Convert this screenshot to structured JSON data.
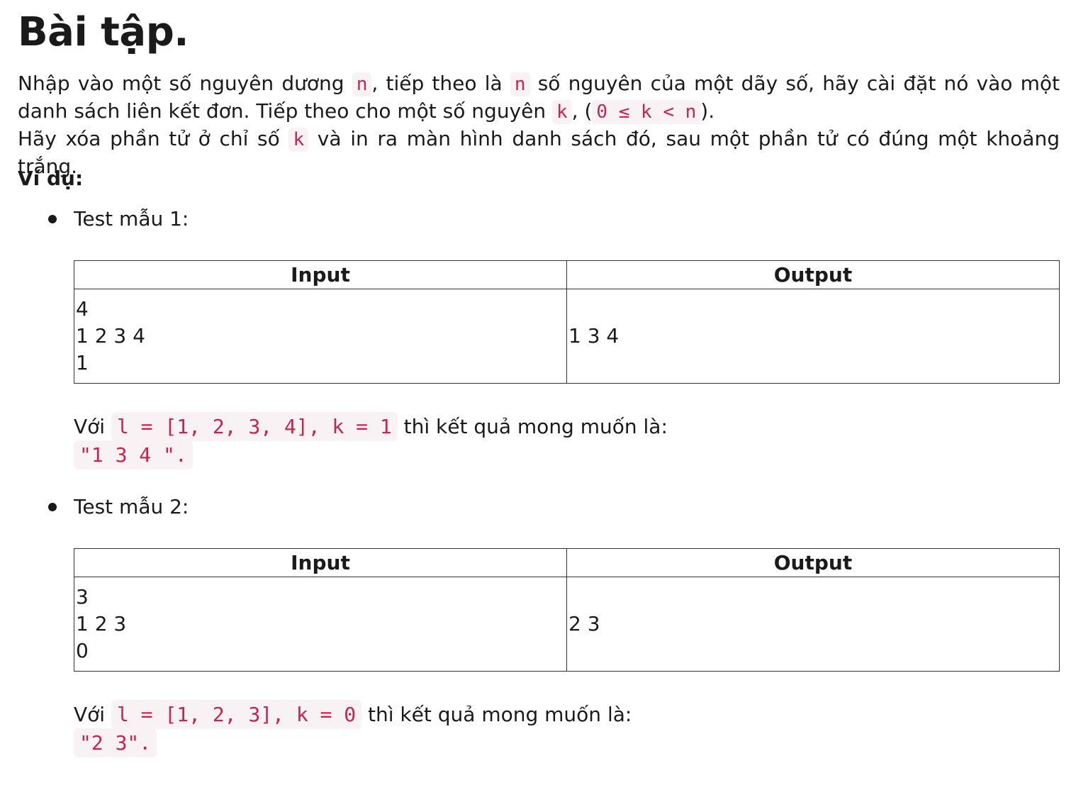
{
  "title": "Bài tập.",
  "description": {
    "line1_a": "Nhập vào một số nguyên dương ",
    "code_n": "n",
    "line1_b": ", tiếp theo là ",
    "line1_c": " số nguyên của một dãy số, hãy cài đặt nó vào một danh sách liên kết đơn. Tiếp theo cho một số nguyên ",
    "code_k": "k",
    "line2_a": ", (",
    "code_range": "0 ≤ k < n",
    "line2_b": ").",
    "line3_a": "Hãy xóa phần tử ở chỉ số ",
    "line3_b": " và in ra màn hình danh sách đó, sau một phần tử có đúng một khoảng trắng."
  },
  "example_label": "Ví dụ:",
  "tests": [
    {
      "label": "Test mẫu 1:",
      "input_header": "Input",
      "output_header": "Output",
      "input_lines": [
        "4",
        "1 2 3 4",
        "1"
      ],
      "output": "1 3 4",
      "note_prefix": "Với ",
      "note_code": "l = [1, 2, 3, 4], k = 1",
      "note_suffix": " thì kết quả mong muốn là:",
      "expected": "\"1 3 4 \"."
    },
    {
      "label": "Test mẫu 2:",
      "input_header": "Input",
      "output_header": "Output",
      "input_lines": [
        "3",
        "1 2 3",
        "0"
      ],
      "output": "2 3",
      "note_prefix": "Với ",
      "note_code": "l = [1, 2, 3], k = 0",
      "note_suffix": " thì kết quả mong muốn là:",
      "expected": "\"2 3\"."
    }
  ]
}
